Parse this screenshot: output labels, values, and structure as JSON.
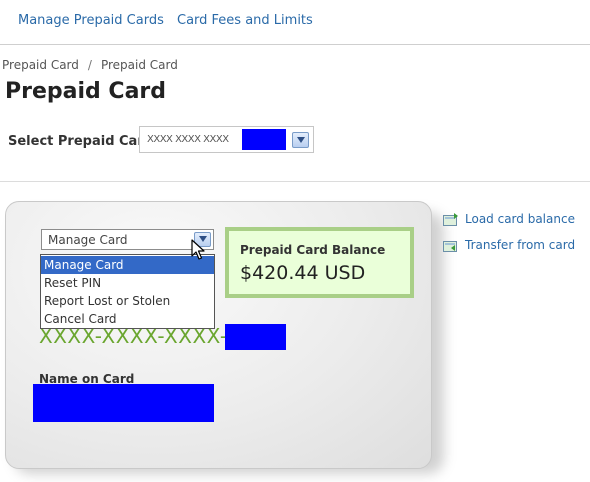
{
  "topnav": {
    "items": [
      {
        "label": "Manage Prepaid Cards"
      },
      {
        "label": "Card Fees and Limits"
      }
    ]
  },
  "breadcrumb": {
    "items": [
      "Prepaid Card",
      "Prepaid Card"
    ],
    "separator": "/"
  },
  "page": {
    "title": "Prepaid Card"
  },
  "card_select": {
    "label": "Select Prepaid Card",
    "value": "XXXX XXXX XXXX"
  },
  "card": {
    "action_select": {
      "value": "Manage Card",
      "options": [
        "Manage Card",
        "Reset PIN",
        "Report Lost or Stolen",
        "Cancel Card"
      ],
      "highlighted_index": 0
    },
    "balance": {
      "label": "Prepaid Card Balance",
      "amount": "$420.44 USD"
    },
    "number_masked": "XXXX-XXXX-XXXX-",
    "name_label": "Name on Card"
  },
  "side_links": [
    {
      "label": "Load card balance",
      "icon": "load-balance-icon"
    },
    {
      "label": "Transfer from card",
      "icon": "transfer-icon"
    }
  ],
  "colors": {
    "link": "#2a6aa8",
    "balance_bg": "#eaffd9",
    "balance_border": "#a9cf87",
    "card_number": "#6aa62f",
    "dropdown_highlight": "#3369c7",
    "redaction": "#0000ff"
  }
}
